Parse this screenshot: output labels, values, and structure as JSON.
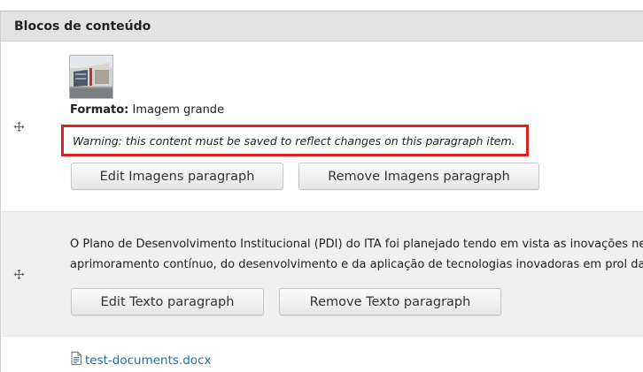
{
  "section": {
    "title": "Blocos de conteúdo"
  },
  "image_paragraph": {
    "format_label": "Formato:",
    "format_value": "Imagem grande",
    "warning": "Warning: this content must be saved to reflect changes on this paragraph item.",
    "edit_label": "Edit Imagens paragraph",
    "remove_label": "Remove Imagens paragraph",
    "thumbnail_icon": "image-thumbnail"
  },
  "text_paragraph": {
    "lines": [
      "O Plano de Desenvolvimento Institucional (PDI) do ITA foi planejado tendo em vista as inovações neces",
      "aprimoramento contínuo, do desenvolvimento e da aplicação de tecnologias inovadoras em prol da ed"
    ],
    "edit_label": "Edit Texto paragraph",
    "remove_label": "Remove Texto paragraph"
  },
  "file_paragraph": {
    "filename": "test-documents.docx",
    "icon": "document-icon"
  },
  "colors": {
    "warning_border": "#e02020",
    "link": "#1a6fb5",
    "header_bg": "#e3e3e3"
  }
}
